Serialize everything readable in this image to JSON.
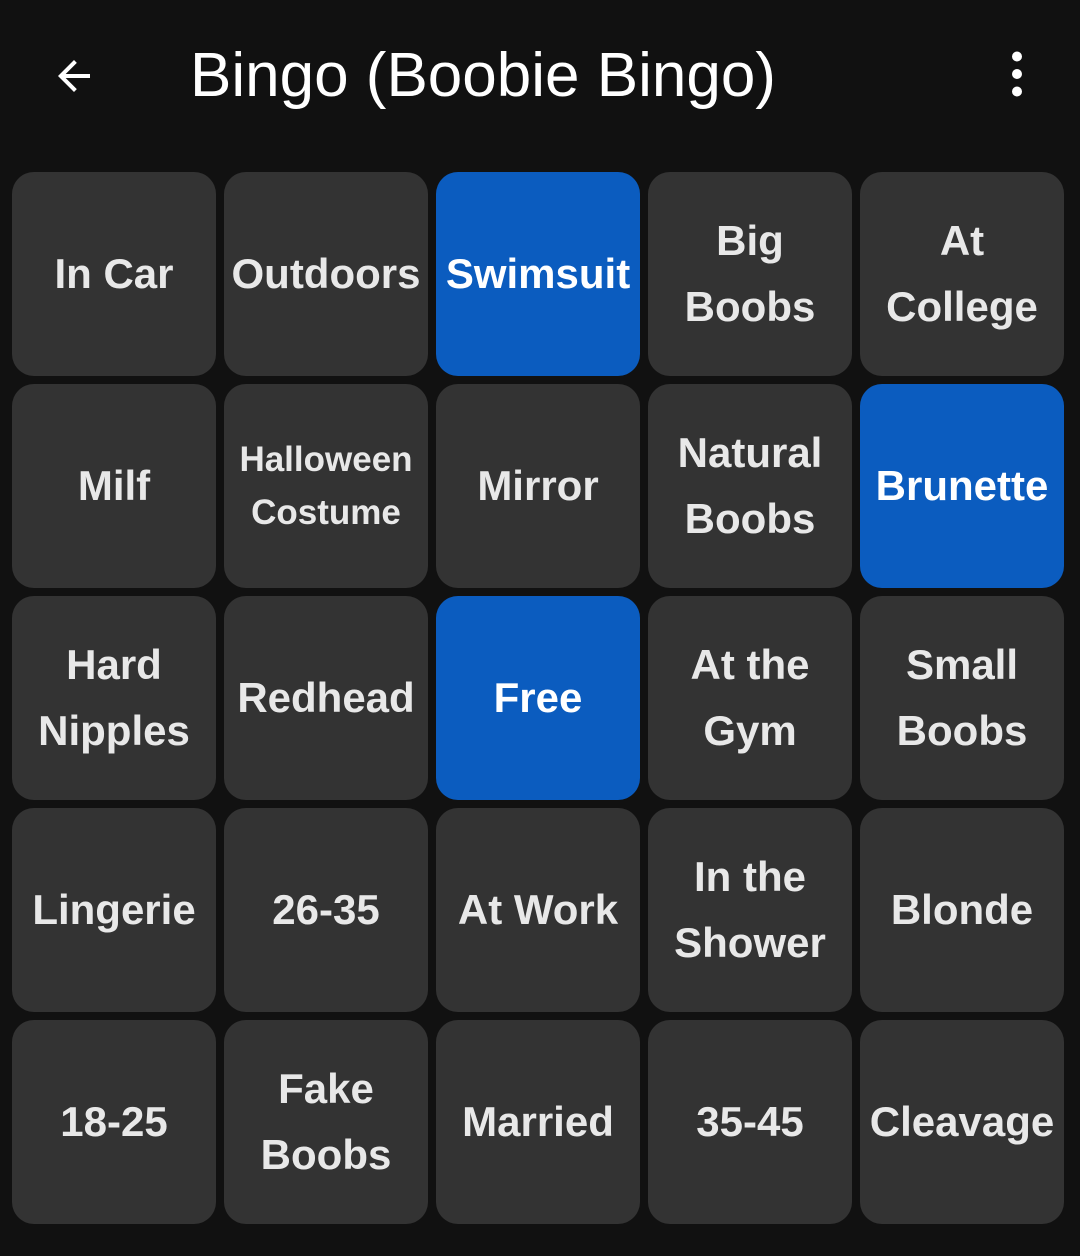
{
  "app_bar": {
    "back_icon": "arrow-left-icon",
    "title": "Bingo (Boobie Bingo)",
    "more_icon": "more-vertical-icon"
  },
  "colors": {
    "background": "#111111",
    "cell": "#333333",
    "cell_marked": "#0b5cbf",
    "text": "#e8e8e8"
  },
  "board": {
    "cells": [
      {
        "label": "In Car",
        "marked": false
      },
      {
        "label": "Outdoors",
        "marked": false
      },
      {
        "label": "Swimsuit",
        "marked": true
      },
      {
        "label": "Big Boobs",
        "marked": false
      },
      {
        "label": "At College",
        "marked": false
      },
      {
        "label": "Milf",
        "marked": false
      },
      {
        "label": "Halloween Costume",
        "marked": false
      },
      {
        "label": "Mirror",
        "marked": false
      },
      {
        "label": "Natural Boobs",
        "marked": false
      },
      {
        "label": "Brunette",
        "marked": true
      },
      {
        "label": "Hard Nipples",
        "marked": false
      },
      {
        "label": "Redhead",
        "marked": false
      },
      {
        "label": "Free",
        "marked": true
      },
      {
        "label": "At the Gym",
        "marked": false
      },
      {
        "label": "Small Boobs",
        "marked": false
      },
      {
        "label": "Lingerie",
        "marked": false
      },
      {
        "label": "26-35",
        "marked": false
      },
      {
        "label": "At Work",
        "marked": false
      },
      {
        "label": "In the Shower",
        "marked": false
      },
      {
        "label": "Blonde",
        "marked": false
      },
      {
        "label": "18-25",
        "marked": false
      },
      {
        "label": "Fake Boobs",
        "marked": false
      },
      {
        "label": "Married",
        "marked": false
      },
      {
        "label": "35-45",
        "marked": false
      },
      {
        "label": "Cleavage",
        "marked": false
      }
    ]
  }
}
